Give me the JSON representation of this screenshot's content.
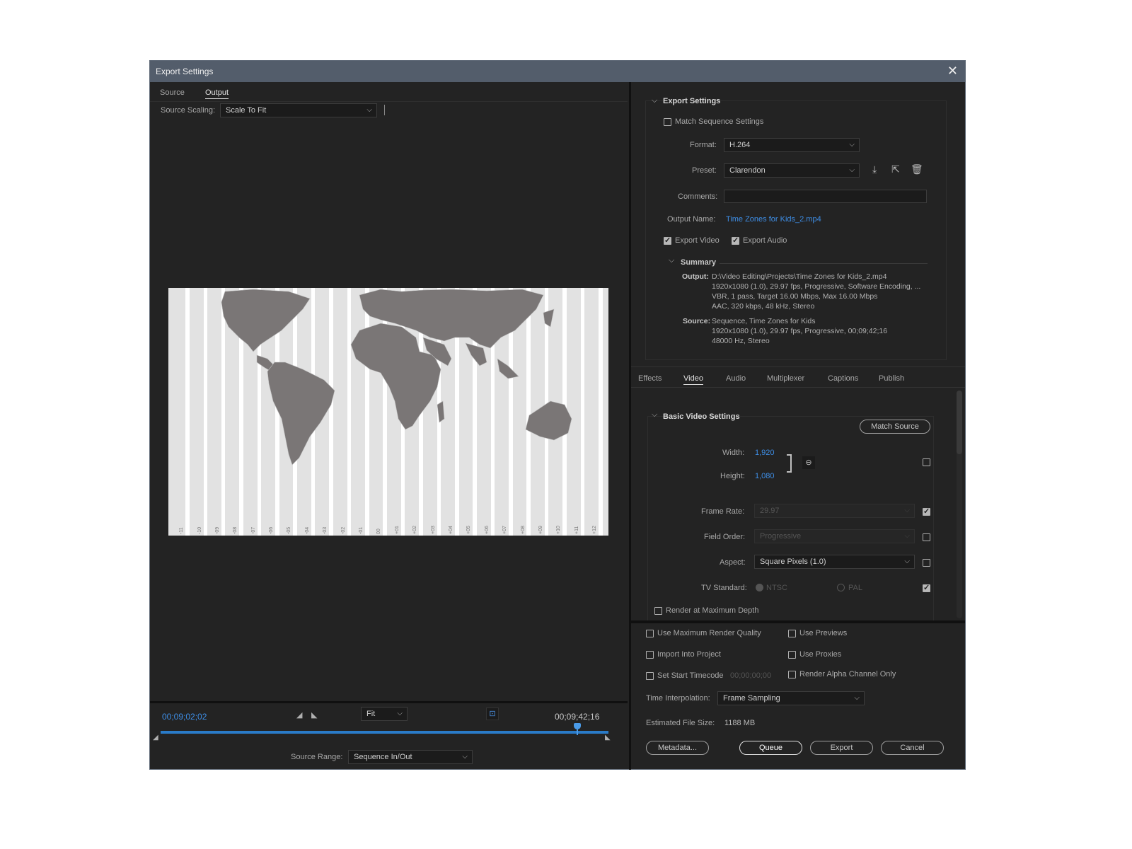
{
  "window": {
    "title": "Export Settings"
  },
  "left": {
    "tabs": [
      {
        "label": "Source"
      },
      {
        "label": "Output"
      }
    ],
    "source_scaling": {
      "label": "Source Scaling:",
      "value": "Scale To Fit"
    },
    "preview_map_labels": [
      "-11",
      "-10",
      "-09",
      "-08",
      "-07",
      "-06",
      "-05",
      "-04",
      "-03",
      "-02",
      "-01",
      "00",
      "+01",
      "+02",
      "+03",
      "+04",
      "+05",
      "+06",
      "+07",
      "+08",
      "+09",
      "+10",
      "+11",
      "+12"
    ],
    "timecode_current": "00;09;02;02",
    "timecode_end": "00;09;42;16",
    "zoom": {
      "value": "Fit"
    },
    "source_range": {
      "label": "Source Range:",
      "value": "Sequence In/Out"
    },
    "playhead_fraction": 0.93
  },
  "export_settings": {
    "heading": "Export Settings",
    "match_sequence": "Match Sequence Settings",
    "format": {
      "label": "Format:",
      "value": "H.264"
    },
    "preset": {
      "label": "Preset:",
      "value": "Clarendon"
    },
    "comments": {
      "label": "Comments:",
      "value": ""
    },
    "output_name": {
      "label": "Output Name:",
      "value": "Time Zones for Kids_2.mp4"
    },
    "export_video": "Export Video",
    "export_audio": "Export Audio",
    "summary": {
      "heading": "Summary",
      "output_label": "Output:",
      "output_lines": [
        "D:\\Video Editing\\Projects\\Time Zones for Kids_2.mp4",
        "1920x1080 (1.0), 29.97 fps, Progressive, Software Encoding, ...",
        "VBR, 1 pass, Target 16.00 Mbps, Max 16.00 Mbps",
        "AAC, 320 kbps, 48 kHz, Stereo"
      ],
      "source_label": "Source:",
      "source_lines": [
        "Sequence, Time Zones for Kids",
        "1920x1080 (1.0), 29.97 fps, Progressive, 00;09;42;16",
        "48000 Hz, Stereo"
      ]
    }
  },
  "settings_tabs": [
    {
      "label": "Effects"
    },
    {
      "label": "Video"
    },
    {
      "label": "Audio"
    },
    {
      "label": "Multiplexer"
    },
    {
      "label": "Captions"
    },
    {
      "label": "Publish"
    }
  ],
  "video": {
    "heading": "Basic Video Settings",
    "match_source": "Match Source",
    "width": {
      "label": "Width:",
      "value": "1,920"
    },
    "height": {
      "label": "Height:",
      "value": "1,080"
    },
    "frame_rate": {
      "label": "Frame Rate:",
      "value": "29.97"
    },
    "field_order": {
      "label": "Field Order:",
      "value": "Progressive"
    },
    "aspect": {
      "label": "Aspect:",
      "value": "Square Pixels (1.0)"
    },
    "tv_standard": {
      "label": "TV Standard:",
      "ntsc": "NTSC",
      "pal": "PAL"
    },
    "render_max_depth": "Render at Maximum Depth"
  },
  "bottom": {
    "use_max_quality": "Use Maximum Render Quality",
    "use_previews": "Use Previews",
    "import_into_project": "Import Into Project",
    "use_proxies": "Use Proxies",
    "set_start_timecode": "Set Start Timecode",
    "start_timecode_value": "00;00;00;00",
    "render_alpha": "Render Alpha Channel Only",
    "time_interpolation": {
      "label": "Time Interpolation:",
      "value": "Frame Sampling"
    },
    "file_size": {
      "label": "Estimated File Size:",
      "value": "1188 MB"
    },
    "buttons": {
      "metadata": "Metadata...",
      "queue": "Queue",
      "export": "Export",
      "cancel": "Cancel"
    }
  }
}
